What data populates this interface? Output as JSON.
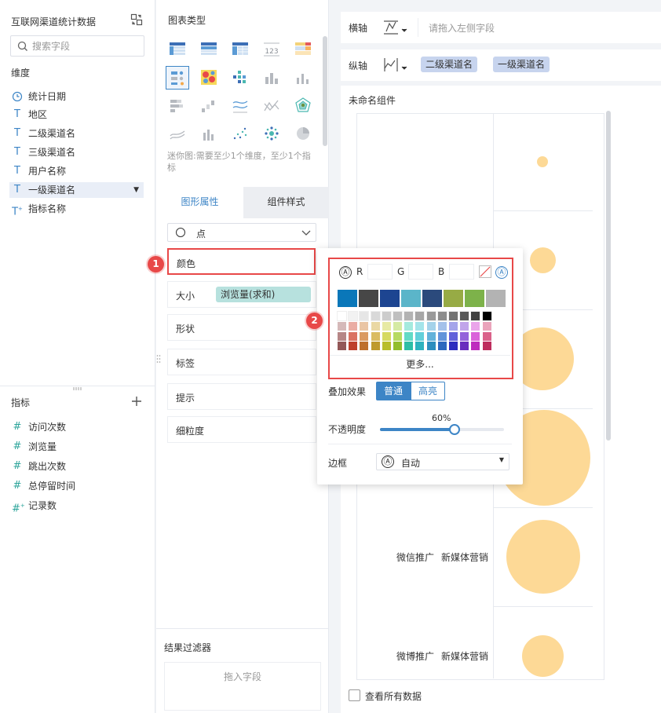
{
  "left": {
    "dataset_title": "互联网渠道统计数据",
    "search_placeholder": "搜索字段",
    "dimension_title": "维度",
    "dimensions": [
      {
        "type": "date",
        "label": "统计日期"
      },
      {
        "type": "text",
        "label": "地区"
      },
      {
        "type": "text",
        "label": "二级渠道名"
      },
      {
        "type": "text",
        "label": "三级渠道名"
      },
      {
        "type": "text",
        "label": "用户名称"
      },
      {
        "type": "text",
        "label": "一级渠道名",
        "selected": true
      },
      {
        "type": "text-derived",
        "label": "指标名称"
      }
    ],
    "metric_title": "指标",
    "metrics": [
      {
        "label": "访问次数"
      },
      {
        "label": "浏览量"
      },
      {
        "label": "跳出次数"
      },
      {
        "label": "总停留时间"
      },
      {
        "label": "记录数",
        "derived": true
      }
    ],
    "icons": {
      "switch": "switch-dataset-icon",
      "search": "search-icon",
      "add": "plus-icon"
    }
  },
  "middle": {
    "chart_type_title": "图表类型",
    "chart_type_hint": "迷你图:需要至少1个维度，至少1个指标",
    "chart_types": [
      "table-icon",
      "grouped-table-icon",
      "cross-table-icon",
      "kpi-icon",
      "heat-table-icon",
      "scatter-matrix-icon",
      "heatmap-icon",
      "scatter-icon",
      "bar-icon",
      "column-icon",
      "stacked-bar-icon",
      "waterfall-icon",
      "line-icon",
      "area-icon",
      "radar-icon",
      "mini-line-icon",
      "mini-bar-icon",
      "dot-icon",
      "bubble-icon",
      "pie-icon"
    ],
    "selected_chart_type": "scatter-matrix-icon",
    "tab_graph": "图形属性",
    "tab_style": "组件样式",
    "shape_select": "点",
    "prop_color": "颜色",
    "prop_size": "大小",
    "size_field": "浏览量(求和)",
    "prop_shape": "形状",
    "prop_label": "标签",
    "prop_tooltip": "提示",
    "prop_granularity": "细粒度",
    "filter_title": "结果过滤器",
    "filter_placeholder": "拖入字段"
  },
  "right": {
    "x_axis_label": "横轴",
    "x_axis_placeholder": "请拖入左侧字段",
    "y_axis_label": "纵轴",
    "y_axis_fields": [
      "二级渠道名",
      "一级渠道名"
    ],
    "widget_title": "未命名组件",
    "show_all_label": "查看所有数据",
    "rows": [
      {
        "sub": "",
        "main": ""
      },
      {
        "sub": "",
        "main": ""
      },
      {
        "sub": "",
        "main": ""
      },
      {
        "sub": "",
        "main": ""
      },
      {
        "sub": "微信推广",
        "main": "新媒体营销"
      },
      {
        "sub": "微博推广",
        "main": "新媒体营销"
      }
    ],
    "bubble_color": "#fdd996"
  },
  "popover": {
    "r_label": "R",
    "g_label": "G",
    "b_label": "B",
    "r_value": "",
    "g_value": "",
    "b_value": "",
    "auto_glyph": "Ⓐ",
    "theme_colors": [
      "#0a77b9",
      "#474747",
      "#1d4591",
      "#5bb5c9",
      "#2b4a7c",
      "#97ab45",
      "#7db24a",
      "#b3b3b3"
    ],
    "more_label": "更多...",
    "overlay_label": "叠加效果",
    "overlay_normal": "普通",
    "overlay_highlight": "高亮",
    "opacity_label": "不透明度",
    "opacity_value": "60%",
    "opacity": 0.6,
    "border_label": "边框",
    "border_value": "自动"
  },
  "callouts": [
    "1",
    "2"
  ]
}
